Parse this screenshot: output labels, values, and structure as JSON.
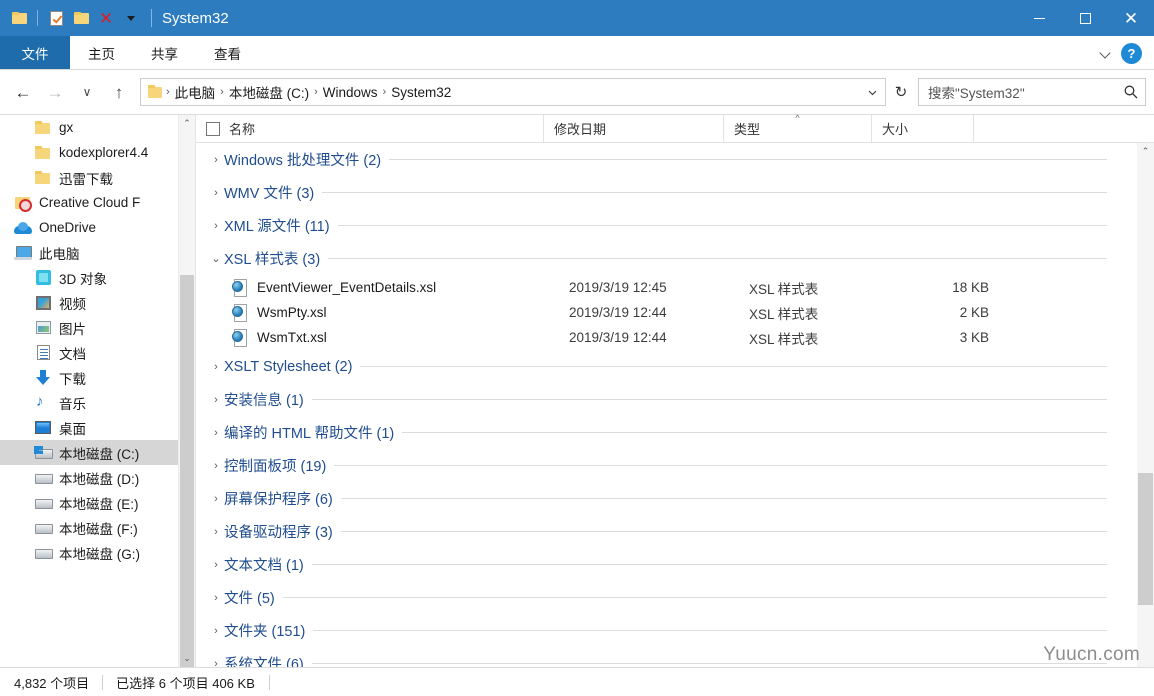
{
  "window": {
    "title": "System32",
    "quick_access": [
      {
        "name": "folder-icon",
        "label": "文件夹"
      },
      {
        "name": "properties-icon",
        "label": "属性"
      },
      {
        "name": "new-folder-icon",
        "label": "新建文件夹"
      },
      {
        "name": "delete-icon",
        "label": "删除"
      },
      {
        "name": "customize-dropdown-icon",
        "label": "自定义快速访问工具栏"
      }
    ],
    "controls": {
      "minimize": "最小化",
      "maximize": "最大化",
      "close": "关闭"
    }
  },
  "ribbon": {
    "tabs": [
      {
        "label": "文件",
        "active": true
      },
      {
        "label": "主页",
        "active": false
      },
      {
        "label": "共享",
        "active": false
      },
      {
        "label": "查看",
        "active": false
      }
    ],
    "collapse_label": "展开功能区",
    "help_label": "?"
  },
  "navigation": {
    "back": "←",
    "forward": "→",
    "recent": "∨",
    "up": "↑",
    "refresh": "↻",
    "breadcrumbs": [
      "此电脑",
      "本地磁盘 (C:)",
      "Windows",
      "System32"
    ],
    "breadcrumb_separator": "›",
    "dropdown": "∨"
  },
  "search": {
    "placeholder": "搜索\"System32\""
  },
  "sidebar": {
    "items": [
      {
        "label": "gx",
        "icon": "folder-icon",
        "indent": 2,
        "selected": false
      },
      {
        "label": "kodexplorer4.4",
        "icon": "folder-icon",
        "indent": 2,
        "selected": false
      },
      {
        "label": "迅雷下载",
        "icon": "folder-icon",
        "indent": 2,
        "selected": false
      },
      {
        "label": "Creative Cloud F",
        "icon": "creative-cloud-icon",
        "indent": 1,
        "selected": false
      },
      {
        "label": "OneDrive",
        "icon": "onedrive-cloud-icon",
        "indent": 1,
        "selected": false
      },
      {
        "label": "此电脑",
        "icon": "this-pc-icon",
        "indent": 1,
        "selected": false
      },
      {
        "label": "3D 对象",
        "icon": "3d-objects-icon",
        "indent": 2,
        "selected": false
      },
      {
        "label": "视频",
        "icon": "videos-icon",
        "indent": 2,
        "selected": false
      },
      {
        "label": "图片",
        "icon": "pictures-icon",
        "indent": 2,
        "selected": false
      },
      {
        "label": "文档",
        "icon": "documents-icon",
        "indent": 2,
        "selected": false
      },
      {
        "label": "下载",
        "icon": "downloads-icon",
        "indent": 2,
        "selected": false
      },
      {
        "label": "音乐",
        "icon": "music-icon",
        "indent": 2,
        "selected": false
      },
      {
        "label": "桌面",
        "icon": "desktop-icon",
        "indent": 2,
        "selected": false
      },
      {
        "label": "本地磁盘 (C:)",
        "icon": "system-drive-icon",
        "indent": 2,
        "selected": true
      },
      {
        "label": "本地磁盘 (D:)",
        "icon": "drive-icon",
        "indent": 2,
        "selected": false
      },
      {
        "label": "本地磁盘 (E:)",
        "icon": "drive-icon",
        "indent": 2,
        "selected": false
      },
      {
        "label": "本地磁盘 (F:)",
        "icon": "drive-icon",
        "indent": 2,
        "selected": false
      },
      {
        "label": "本地磁盘 (G:)",
        "icon": "drive-icon",
        "indent": 2,
        "selected": false
      }
    ]
  },
  "filelist": {
    "columns": {
      "name": "名称",
      "date": "修改日期",
      "type": "类型",
      "size": "大小"
    },
    "sort": {
      "column": "类型",
      "direction": "ascending",
      "glyph": "^"
    },
    "chevron_collapsed": "›",
    "chevron_expanded": "⌄",
    "groups": [
      {
        "label": "Windows 批处理文件 (2)",
        "expanded": false,
        "files": []
      },
      {
        "label": "WMV 文件 (3)",
        "expanded": false,
        "files": []
      },
      {
        "label": "XML 源文件 (11)",
        "expanded": false,
        "files": []
      },
      {
        "label": "XSL 样式表 (3)",
        "expanded": true,
        "files": [
          {
            "name": "EventViewer_EventDetails.xsl",
            "date": "2019/3/19 12:45",
            "type": "XSL 样式表",
            "size": "18 KB",
            "icon": "xsl-file-icon"
          },
          {
            "name": "WsmPty.xsl",
            "date": "2019/3/19 12:44",
            "type": "XSL 样式表",
            "size": "2 KB",
            "icon": "xsl-file-icon"
          },
          {
            "name": "WsmTxt.xsl",
            "date": "2019/3/19 12:44",
            "type": "XSL 样式表",
            "size": "3 KB",
            "icon": "xsl-file-icon"
          }
        ]
      },
      {
        "label": "XSLT Stylesheet (2)",
        "expanded": false,
        "files": []
      },
      {
        "label": "安装信息 (1)",
        "expanded": false,
        "files": []
      },
      {
        "label": "编译的 HTML 帮助文件 (1)",
        "expanded": false,
        "files": []
      },
      {
        "label": "控制面板项 (19)",
        "expanded": false,
        "files": []
      },
      {
        "label": "屏幕保护程序 (6)",
        "expanded": false,
        "files": []
      },
      {
        "label": "设备驱动程序 (3)",
        "expanded": false,
        "files": []
      },
      {
        "label": "文本文档 (1)",
        "expanded": false,
        "files": []
      },
      {
        "label": "文件 (5)",
        "expanded": false,
        "files": []
      },
      {
        "label": "文件夹 (151)",
        "expanded": false,
        "files": []
      },
      {
        "label": "系统文件 (6)",
        "expanded": false,
        "files": []
      }
    ]
  },
  "statusbar": {
    "item_count": "4,832 个项目",
    "selection": "已选择 6 个项目  406 KB"
  },
  "watermark": "Yuucn.com",
  "colors": {
    "titlebar": "#2c7cbf",
    "file_tab": "#1e6cab",
    "group_label": "#1f4d8f",
    "selection": "#d6d6d6",
    "accent": "#1e8ad6"
  }
}
